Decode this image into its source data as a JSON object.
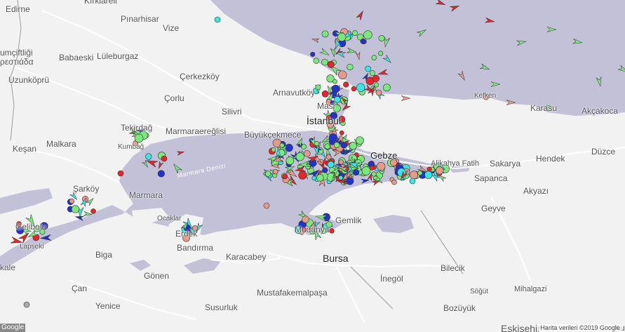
{
  "colors": {
    "land": "#f2f2f2",
    "water": "#c3c1d8",
    "road": "#ffffff",
    "ship_cargo": "#7be87b",
    "ship_tanker": "#e6262a",
    "ship_passenger": "#2233cc",
    "ship_pleasure": "#e89a8a",
    "ship_tug": "#39e6e6"
  },
  "places": {
    "edirne": "Edirne",
    "kirklareli": "Kırklareli",
    "pinarhisar": "Pınarhisar",
    "vize": "Vize",
    "cumcumfitligi": "umçiftliği",
    "pythio": "ρεστιάδα",
    "babaeski": "Babaeski",
    "luleburgaz": "Lüleburgaz",
    "uzunkopru": "Uzunköprü",
    "cerkezkoy": "Çerkezköy",
    "corlu": "Çorlu",
    "arnavutkoy": "Arnavutköy",
    "silivri": "Silivri",
    "tekirdag": "Tekirdağ",
    "marmaraereglisi": "Marmaraereğlisi",
    "buyukcekmece": "Büyükçekmece",
    "istanbul": "İstanbul",
    "keşan": "Keşan",
    "malkara": "Malkara",
    "kumbag": "Kumbağ",
    "sarkoy": "Şarköy",
    "marmara": "Marmara",
    "gelibolu": "Gelibolu",
    "lapseki": "Lapseki",
    "kale": "kale",
    "ocaklar": "Ocaklar",
    "erdek": "Erdek",
    "bandirma": "Bandırma",
    "biga": "Biga",
    "karacabey": "Karacabey",
    "gonen": "Gönen",
    "can": "Çan",
    "yenice": "Yenice",
    "susurluk": "Susurluk",
    "mustafakemalpasa": "Mustafakemalpaşa",
    "bursa": "Bursa",
    "inegol": "İnegöl",
    "bilecik": "Bilecik",
    "bozuyuk": "Bozüyük",
    "sogut": "Söğüt",
    "mihalgazi": "Mihalgazi",
    "eskisehir": "Eskişehir",
    "gebze": "Gebze",
    "gemlik": "Gemlik",
    "mudanya": "Mudanya",
    "alikahya": "Alikahya Fatih",
    "sakarya": "Sakarya",
    "sapanca": "Sapanca",
    "hendek": "Hendek",
    "duzce": "Düzce",
    "akyazi": "Akyazı",
    "geyve": "Geyve",
    "kefken": "Kefken",
    "karasu": "Karasu",
    "akcakoca": "Akçakoca",
    "masl": "Masl",
    "ku": "Ku"
  },
  "sea_label": "Marmara Denizi",
  "attribution": "Harita verileri ©2019 Google",
  "google_logo": "Google"
}
